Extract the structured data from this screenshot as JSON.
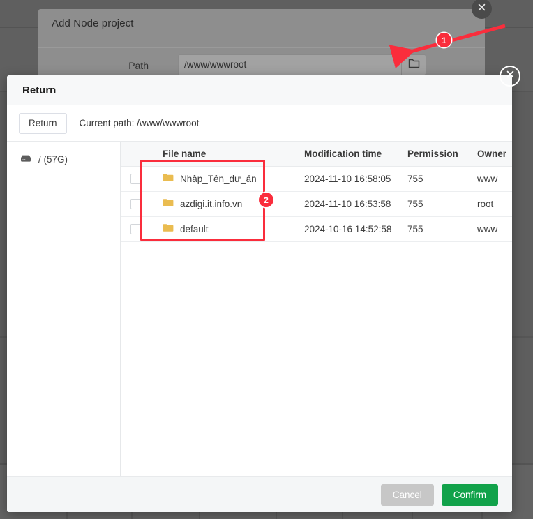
{
  "background_dialog": {
    "title": "Add Node project",
    "field_label": "Path",
    "field_value": "/www/wwwroot",
    "field_placeholder": "/www/wwwroot",
    "browse_icon": "folder-icon",
    "close_icon": "close-icon"
  },
  "return_dialog": {
    "title": "Return",
    "close_icon": "close-icon",
    "toolbar": {
      "return_button": "Return",
      "current_path_label": "Current path: /www/wwwroot"
    },
    "sidebar": {
      "items": [
        {
          "icon": "disk-icon",
          "label": "/ (57G)"
        }
      ]
    },
    "table": {
      "columns": [
        "",
        "File name",
        "Modification time",
        "Permission",
        "Owner"
      ],
      "rows": [
        {
          "icon": "folder-icon",
          "name": "Nhập_Tên_dự_án",
          "time": "2024-11-10 16:58:05",
          "permission": "755",
          "owner": "www"
        },
        {
          "icon": "folder-icon",
          "name": "azdigi.it.info.vn",
          "time": "2024-11-10 16:53:58",
          "permission": "755",
          "owner": "root"
        },
        {
          "icon": "folder-icon",
          "name": "default",
          "time": "2024-10-16 14:52:58",
          "permission": "755",
          "owner": "www"
        }
      ]
    },
    "footer": {
      "cancel": "Cancel",
      "confirm": "Confirm"
    }
  },
  "annotations": {
    "arrow_color": "#fa2d3c",
    "highlight_color": "#fa2d3c",
    "badge_1": "1",
    "badge_2": "2"
  },
  "colors": {
    "confirm_green": "#11a24a",
    "cancel_gray": "#c7c7c7",
    "folder_yellow": "#eabc50",
    "overlay": "#616161"
  }
}
